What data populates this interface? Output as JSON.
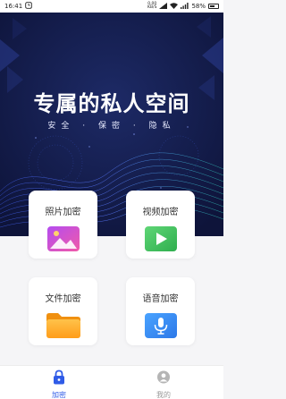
{
  "status_bar": {
    "time": "16:41",
    "net_speed_value": "0.00",
    "net_speed_unit": "KB/S",
    "battery": "58%"
  },
  "hero": {
    "title": "专属的私人空间",
    "subtitle": "安全 · 保密 · 隐私"
  },
  "cards": [
    {
      "label": "照片加密",
      "icon": "image-icon",
      "color": "#d54bd8"
    },
    {
      "label": "视频加密",
      "icon": "play-icon",
      "color": "#3ec25f"
    },
    {
      "label": "文件加密",
      "icon": "folder-icon",
      "color": "#ffa91e"
    },
    {
      "label": "语音加密",
      "icon": "microphone-icon",
      "color": "#3a8cf5"
    }
  ],
  "bottom_nav": {
    "items": [
      {
        "label": "加密",
        "icon": "lock-icon",
        "active": true
      },
      {
        "label": "我的",
        "icon": "user-icon",
        "active": false
      }
    ],
    "active_color": "#2f5be7"
  }
}
